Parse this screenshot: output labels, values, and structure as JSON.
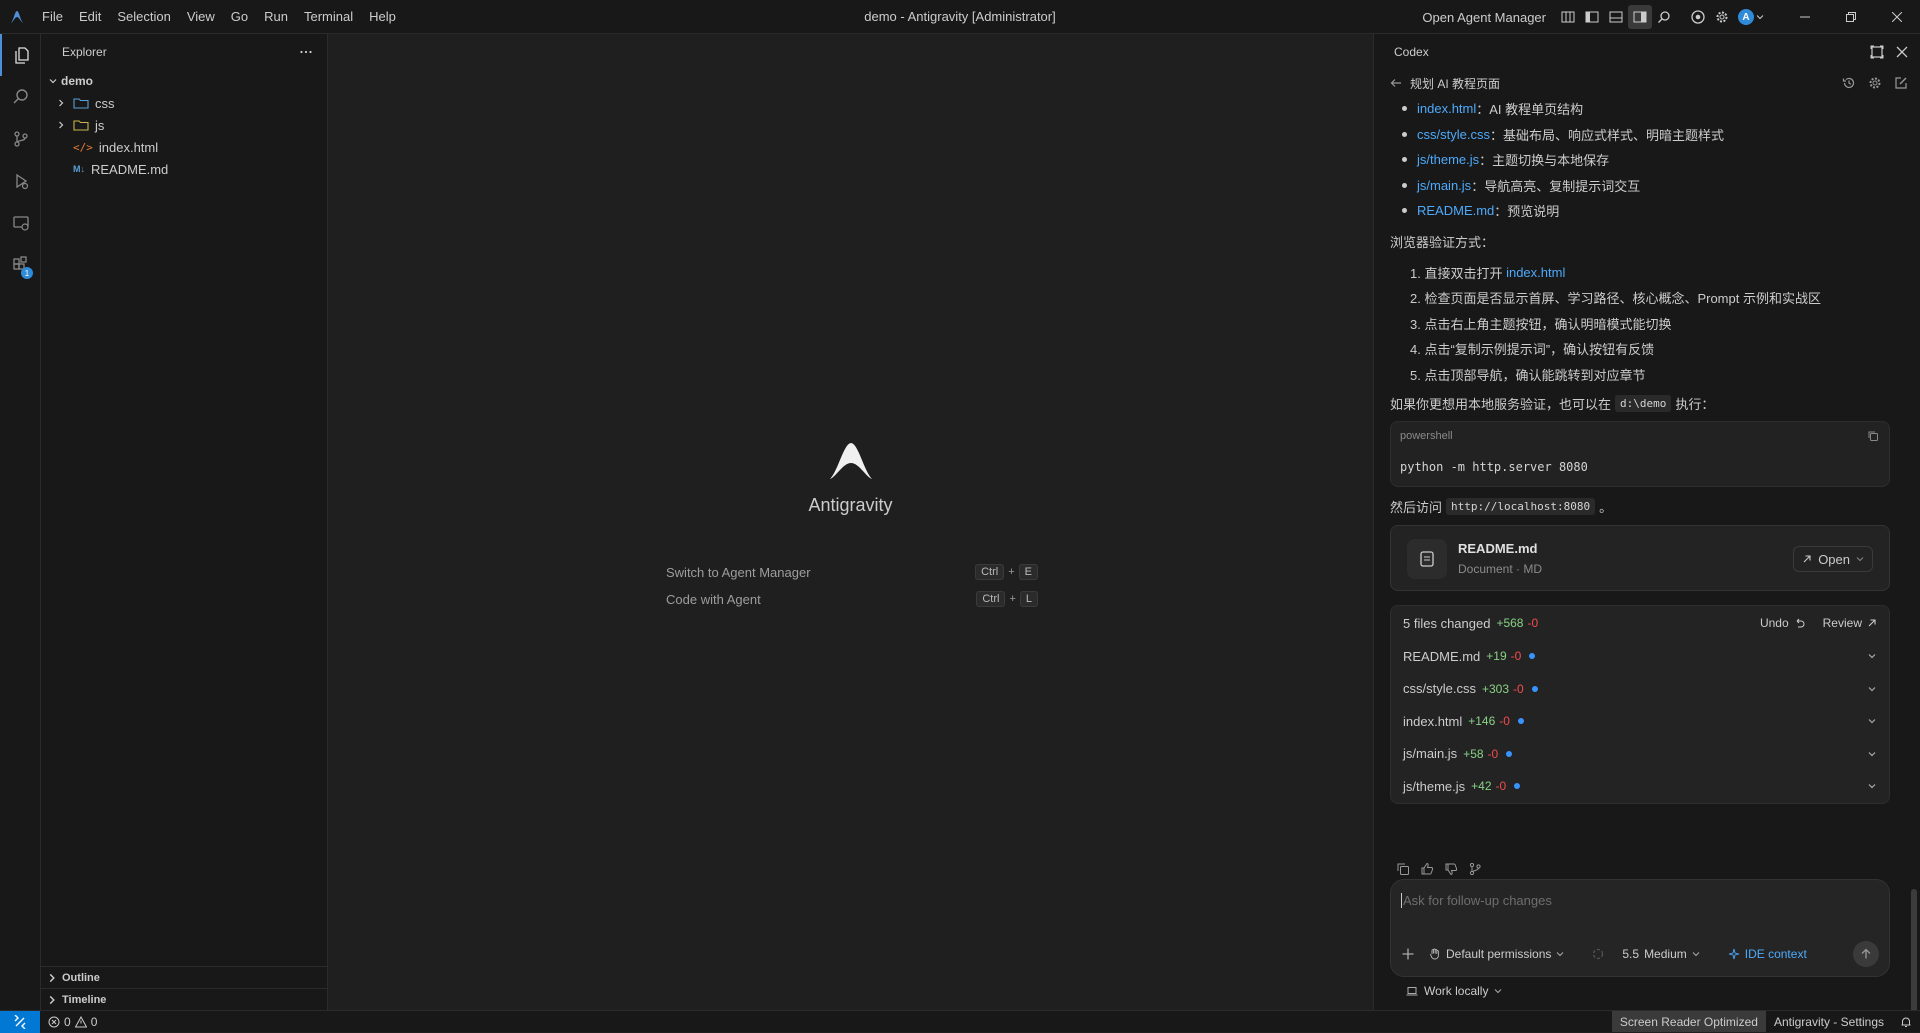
{
  "titlebar": {
    "menu": [
      "File",
      "Edit",
      "Selection",
      "View",
      "Go",
      "Run",
      "Terminal",
      "Help"
    ],
    "title": "demo - Antigravity [Administrator]",
    "open_agent_manager": "Open Agent Manager",
    "avatar_letter": "A"
  },
  "sidebar": {
    "title": "Explorer",
    "root": "demo",
    "items": [
      {
        "label": "css",
        "type": "folder"
      },
      {
        "label": "js",
        "type": "folder"
      },
      {
        "label": "index.html",
        "type": "html"
      },
      {
        "label": "README.md",
        "type": "md"
      }
    ],
    "outline": "Outline",
    "timeline": "Timeline",
    "extensions_badge": "1"
  },
  "editor": {
    "product": "Antigravity",
    "shortcuts": [
      {
        "label": "Switch to Agent Manager",
        "mod": "Ctrl",
        "key": "E"
      },
      {
        "label": "Code with Agent",
        "mod": "Ctrl",
        "key": "L"
      }
    ]
  },
  "panel": {
    "title": "Codex",
    "thread": "规划 AI 教程页面",
    "files": [
      {
        "link": "index.html",
        "desc": "：AI 教程单页结构"
      },
      {
        "link": "css/style.css",
        "desc": "：基础布局、响应式样式、明暗主题样式"
      },
      {
        "link": "js/theme.js",
        "desc": "：主题切换与本地保存"
      },
      {
        "link": "js/main.js",
        "desc": "：导航高亮、复制提示词交互"
      },
      {
        "link": "README.md",
        "desc": "：预览说明"
      }
    ],
    "verify_heading": "浏览器验证方式：",
    "steps": {
      "s1_pre": "1. 直接双击打开 ",
      "s1_link": "index.html",
      "s2": "2. 检查页面是否显示首屏、学习路径、核心概念、Prompt 示例和实战区",
      "s3": "3. 点击右上角主题按钮，确认明暗模式能切换",
      "s4": "4. 点击“复制示例提示词”，确认按钮有反馈",
      "s5": "5. 点击顶部导航，确认能跳转到对应章节"
    },
    "local_pre": "如果你更想用本地服务验证，也可以在",
    "local_code": "d:\\demo",
    "local_post": "执行：",
    "code_lang": "powershell",
    "code": "python -m http.server 8080",
    "visit_pre": "然后访问",
    "visit_code": "http://localhost:8080",
    "visit_post": "。",
    "card": {
      "name": "README.md",
      "sub": "Document · MD",
      "open": "Open"
    },
    "changes": {
      "summary": "5 files changed",
      "add": "+568",
      "del": "-0",
      "undo": "Undo",
      "review": "Review",
      "rows": [
        {
          "file": "README.md",
          "add": "+19",
          "del": "-0"
        },
        {
          "file": "css/style.css",
          "add": "+303",
          "del": "-0"
        },
        {
          "file": "index.html",
          "add": "+146",
          "del": "-0"
        },
        {
          "file": "js/main.js",
          "add": "+58",
          "del": "-0"
        },
        {
          "file": "js/theme.js",
          "add": "+42",
          "del": "-0"
        }
      ]
    },
    "composer": {
      "placeholder": "Ask for follow-up changes",
      "permissions": "Default permissions",
      "model": "5.5",
      "effort": "Medium",
      "ide_context": "IDE context"
    },
    "work_locally": "Work locally"
  },
  "status": {
    "errors": "0",
    "warnings": "0",
    "screen_reader": "Screen Reader Optimized",
    "settings": "Antigravity - Settings"
  }
}
